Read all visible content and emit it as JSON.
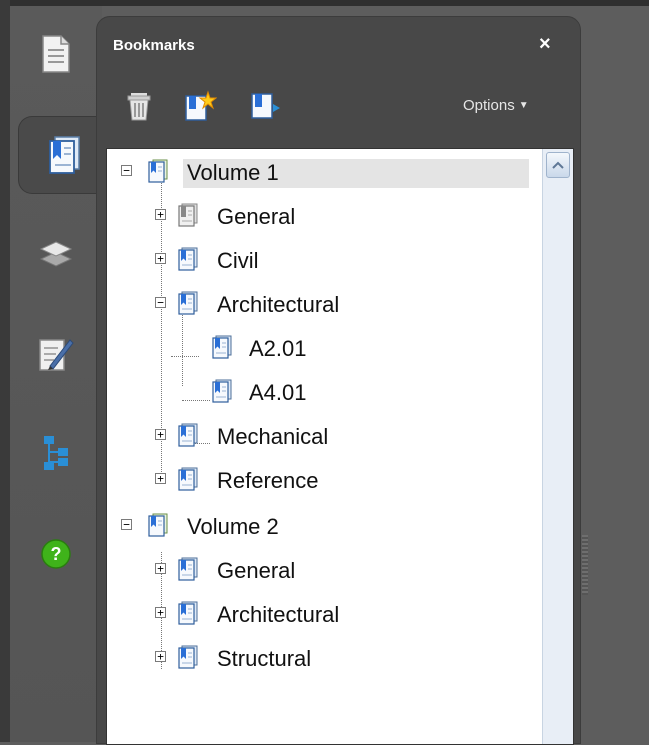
{
  "rail": {
    "items": [
      {
        "name": "pages-icon"
      },
      {
        "name": "bookmarks-icon"
      },
      {
        "name": "layers-icon"
      },
      {
        "name": "signatures-icon"
      },
      {
        "name": "model-tree-icon"
      },
      {
        "name": "help-icon"
      }
    ],
    "active_index": 1
  },
  "panel": {
    "title": "Bookmarks",
    "close_label": "×",
    "options_label": "Options",
    "options_caret": "▼",
    "tools": [
      "delete-bookmark-icon",
      "new-bookmark-icon",
      "expand-bookmark-icon"
    ]
  },
  "tree": {
    "volume1": "Volume 1",
    "v1_general": "General",
    "v1_civil": "Civil",
    "v1_architectural": "Architectural",
    "a201": "A2.01",
    "a401": "A4.01",
    "v1_mechanical": "Mechanical",
    "v1_reference": "Reference",
    "volume2": "Volume 2",
    "v2_general": "General",
    "v2_architectural": "Architectural",
    "v2_structural": "Structural",
    "expand_symbol": "+",
    "collapse_symbol": "−",
    "selected": "Volume 1"
  },
  "colors": {
    "panel_bg": "#484848",
    "rail_bg": "#5a5a5a",
    "bookmark_blue": "#2a6fd6",
    "help_green": "#3fb31a",
    "selected_bg": "#e4e4e4"
  }
}
